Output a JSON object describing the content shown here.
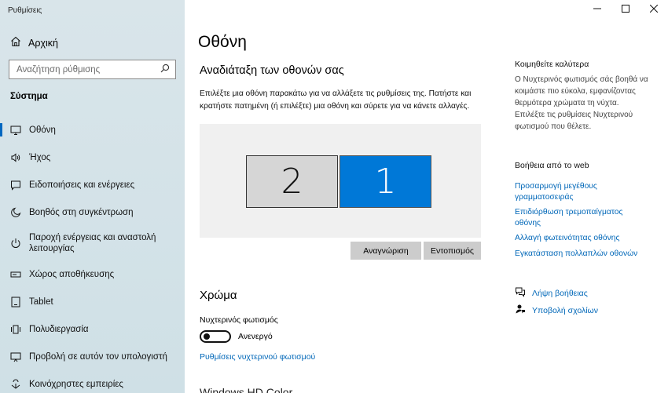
{
  "window": {
    "title": "Ρυθμίσεις"
  },
  "sidebar": {
    "home_label": "Αρχική",
    "search_placeholder": "Αναζήτηση ρύθμισης",
    "section_label": "Σύστημα",
    "items": [
      {
        "label": "Οθόνη",
        "icon": "monitor-icon",
        "active": true
      },
      {
        "label": "Ήχος",
        "icon": "speaker-icon"
      },
      {
        "label": "Ειδοποιήσεις και ενέργειες",
        "icon": "notification-icon"
      },
      {
        "label": "Βοηθός στη συγκέντρωση",
        "icon": "moon-icon"
      },
      {
        "label": "Παροχή ενέργειας και αναστολή λειτουργίας",
        "icon": "power-icon"
      },
      {
        "label": "Χώρος αποθήκευσης",
        "icon": "storage-icon"
      },
      {
        "label": "Tablet",
        "icon": "tablet-icon"
      },
      {
        "label": "Πολυδιεργασία",
        "icon": "multitasking-icon"
      },
      {
        "label": "Προβολή σε αυτόν τον υπολογιστή",
        "icon": "project-icon"
      },
      {
        "label": "Κοινόχρηστες εμπειρίες",
        "icon": "shared-icon"
      }
    ]
  },
  "main": {
    "title": "Οθόνη",
    "arrange_heading": "Αναδιάταξη των οθονών σας",
    "arrange_desc": "Επιλέξτε μια οθόνη παρακάτω για να αλλάξετε τις ρυθμίσεις της. Πατήστε και κρατήστε πατημένη (ή επιλέξτε) μια οθόνη και σύρετε για να κάνετε αλλαγές.",
    "monitor_2": "2",
    "monitor_1": "1",
    "identify_label": "Αναγνώριση",
    "detect_label": "Εντοπισμός",
    "color_heading": "Χρώμα",
    "night_light_label": "Νυχτερινός φωτισμός",
    "night_light_state": "Ανενεργό",
    "night_light_settings_link": "Ρυθμίσεις νυχτερινού φωτισμού",
    "cut_heading": "Windows HD Color"
  },
  "right": {
    "sleep_heading": "Κοιμηθείτε καλύτερα",
    "sleep_text": "Ο Νυχτερινός φωτισμός σάς βοηθά να κοιμάστε πιο εύκολα, εμφανίζοντας θερμότερα χρώματα τη νύχτα. Επιλέξτε τις ρυθμίσεις Νυχτερινού φωτισμού που θέλετε.",
    "web_help_heading": "Βοήθεια από το web",
    "links": [
      "Προσαρμογή μεγέθους γραμματοσειράς",
      "Επιδιόρθωση τρεμοπαίγματος οθόνης",
      "Αλλαγή φωτεινότητας οθόνης",
      "Εγκατάσταση πολλαπλών οθονών"
    ],
    "get_help": "Λήψη βοήθειας",
    "feedback": "Υποβολή σχολίων"
  },
  "colors": {
    "accent": "#0078d7",
    "link": "#0067b8",
    "sidebar_bg": "#d3e2e8"
  }
}
